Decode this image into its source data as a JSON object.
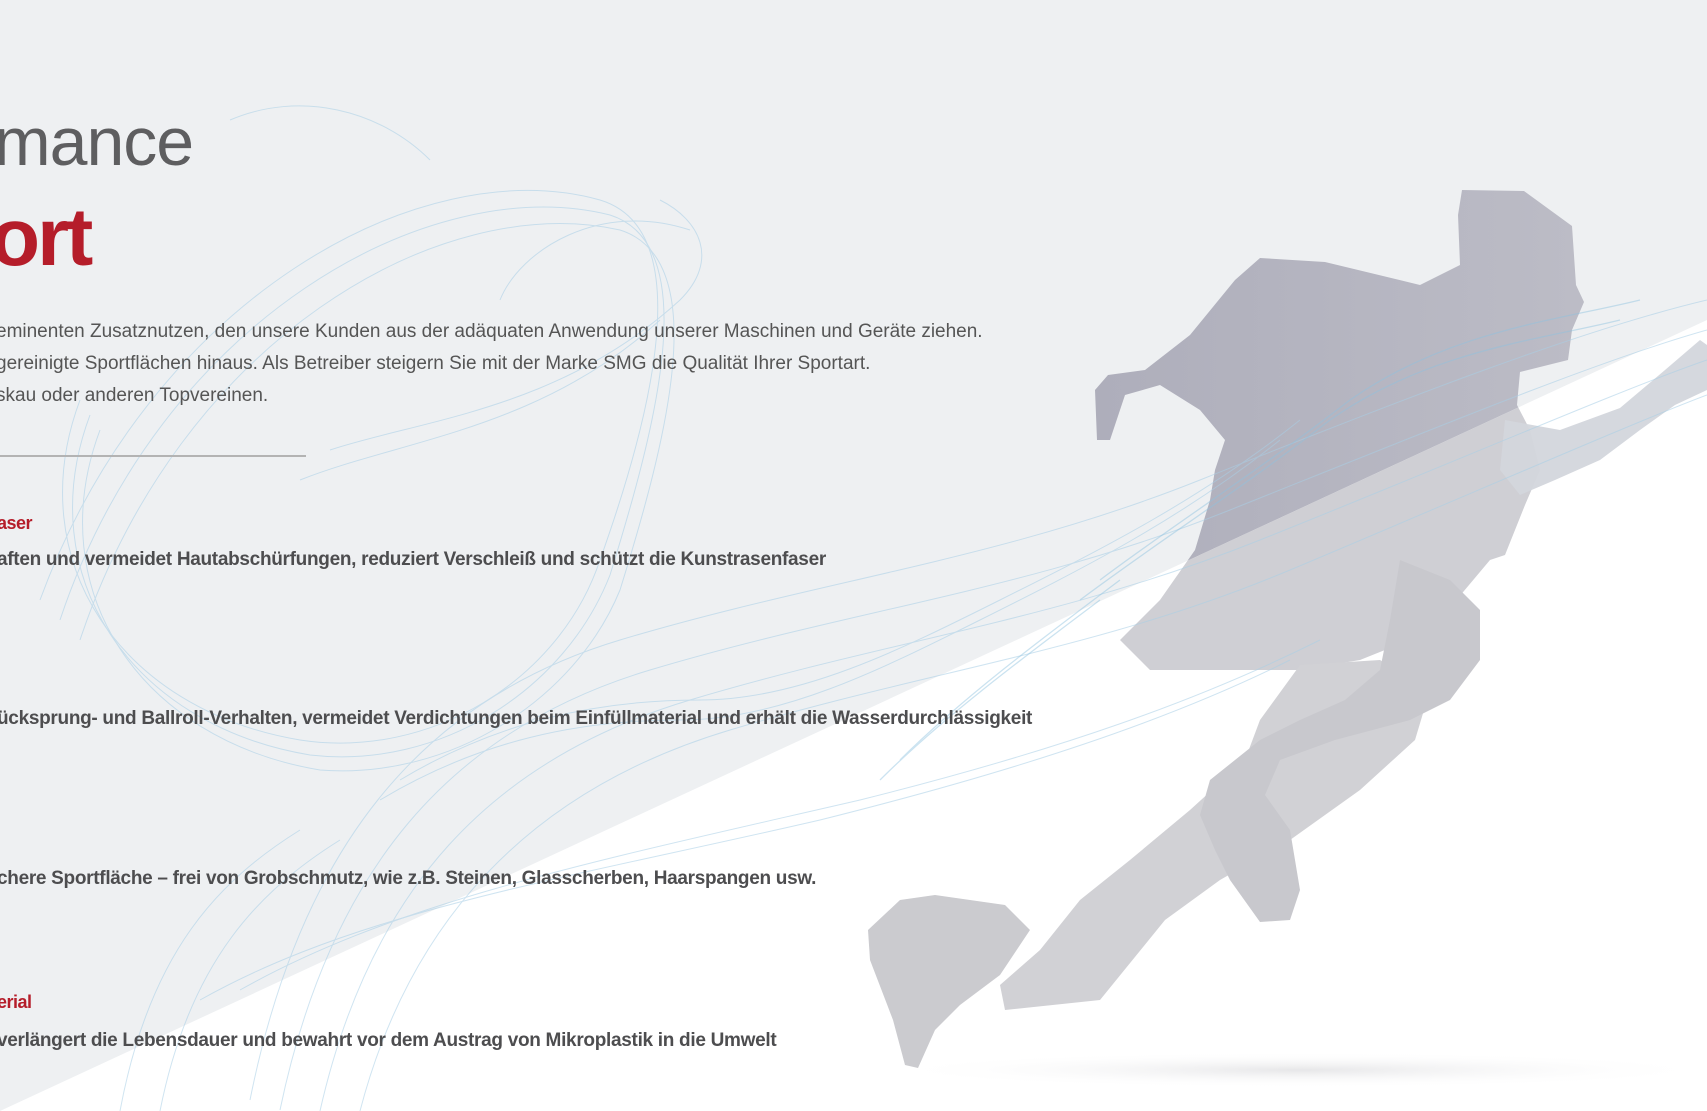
{
  "title": {
    "line1": "mance",
    "line2": "ort"
  },
  "intro": {
    "lines": [
      "eminenten Zusatznutzen, den unsere Kunden aus der adäquaten Anwendung unserer Maschinen und Geräte ziehen.",
      "gereinigte Sportflächen hinaus. Als Betreiber steigern Sie mit der Marke SMG die Qualität Ihrer Sportart.",
      "skau oder anderen Topvereinen."
    ]
  },
  "benefits": [
    {
      "heading": "aser",
      "text": "aften und vermeidet Hautabschürfungen, reduziert Verschleiß und schützt die Kunstrasenfaser"
    },
    {
      "heading": "",
      "text": "ücksprung- und Ballroll-Verhalten, vermeidet Verdichtungen beim Einfüllmaterial und erhält die Wasserdurchlässigkeit"
    },
    {
      "heading": "",
      "text": "chere Sportfläche – frei von Grobschmutz, wie z.B. Steinen, Glasscherben, Haarspangen usw."
    },
    {
      "heading": "erial",
      "text": "verlängert die Lebensdauer und bewahrt vor dem Austrag von Mikroplastik in die Umwelt"
    }
  ],
  "colors": {
    "accent": "#b51d2a",
    "heading_gray": "#5e5e60",
    "body_text": "#4d4d4f",
    "background": "#eef0f2",
    "runner_silhouette": "#b8b8bf",
    "wave_lines": "#a9cfe6"
  },
  "graphics": {
    "runner": "runner-silhouette",
    "waves": "flowing-wave-lines"
  }
}
